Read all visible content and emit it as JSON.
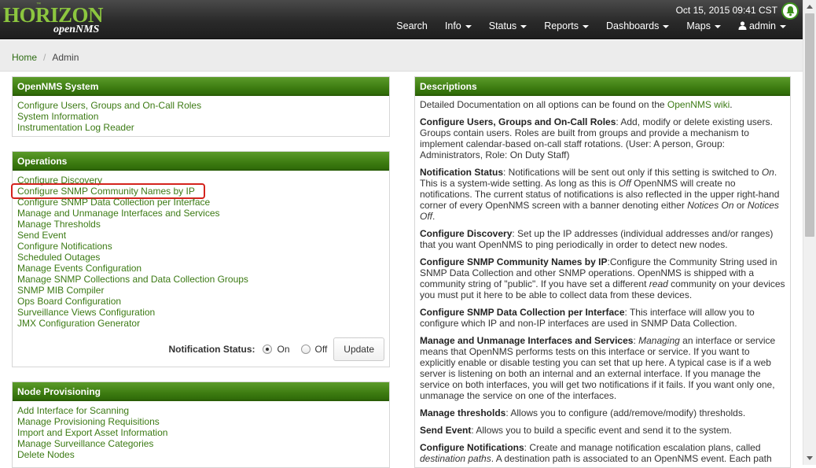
{
  "brand": {
    "logo_main": "HORIZON",
    "logo_sub": "openNMS",
    "logo_tm": "™"
  },
  "header": {
    "datetime": "Oct 15, 2015 09:41 CST",
    "menu": {
      "search": "Search",
      "info": "Info",
      "status": "Status",
      "reports": "Reports",
      "dashboards": "Dashboards",
      "maps": "Maps",
      "user": "admin"
    }
  },
  "breadcrumb": {
    "home": "Home",
    "current": "Admin"
  },
  "opennms_system": {
    "title": "OpenNMS System",
    "links": [
      "Configure Users, Groups and On-Call Roles",
      "System Information",
      "Instrumentation Log Reader"
    ]
  },
  "operations": {
    "title": "Operations",
    "links": [
      "Configure Discovery",
      "Configure SNMP Community Names by IP",
      "Configure SNMP Data Collection per Interface",
      "Manage and Unmanage Interfaces and Services",
      "Manage Thresholds",
      "Send Event",
      "Configure Notifications",
      "Scheduled Outages",
      "Manage Events Configuration",
      "Manage SNMP Collections and Data Collection Groups",
      "SNMP MIB Compiler",
      "Ops Board Configuration",
      "Surveillance Views Configuration",
      "JMX Configuration Generator"
    ],
    "notification_label": "Notification Status:",
    "on_label": "On",
    "off_label": "Off",
    "notification_value": "On",
    "update_button": "Update"
  },
  "node_provisioning": {
    "title": "Node Provisioning",
    "links": [
      "Add Interface for Scanning",
      "Manage Provisioning Requisitions",
      "Import and Export Asset Information",
      "Manage Surveillance Categories",
      "Delete Nodes"
    ]
  },
  "descriptions": {
    "title": "Descriptions",
    "intro_pre": "Detailed Documentation on all options can be found on the ",
    "intro_link": "OpenNMS wiki",
    "intro_post": ".",
    "d1_title": "Configure Users, Groups and On-Call Roles",
    "d1_text": ": Add, modify or delete existing users. Groups contain users. Roles are built from groups and provide a mechanism to implement calendar-based on-call staff rotations. (User: A person, Group: Administrators, Role: On Duty Staff)",
    "d2_title": "Notification Status",
    "d2_a": ": Notifications will be sent out only if this setting is switched to ",
    "d2_on": "On",
    "d2_b": ". This is a system-wide setting. As long as this is ",
    "d2_off": "Off",
    "d2_c": " OpenNMS will create no notifications. The current status of notifications is also reflected in the upper right-hand corner of every OpenNMS screen with a banner denoting either ",
    "d2_notices_on": "Notices On",
    "d2_or": " or ",
    "d2_notices_off": "Notices Off",
    "d2_end": ".",
    "d3_title": "Configure Discovery",
    "d3_text": ": Set up the IP addresses (individual addresses and/or ranges) that you want OpenNMS to ping periodically in order to detect new nodes.",
    "d4_title": "Configure SNMP Community Names by IP",
    "d4_a": ":Configure the Community String used in SNMP Data Collection and other SNMP operations. OpenNMS is shipped with a community string of \"public\". If you have set a different ",
    "d4_read": "read",
    "d4_b": " community on your devices you must put it here to be able to collect data from these devices.",
    "d5_title": "Configure SNMP Data Collection per Interface",
    "d5_text": ": This interface will allow you to configure which IP and non-IP interfaces are used in SNMP Data Collection.",
    "d6_title": "Manage and Unmanage Interfaces and Services",
    "d6_a": ": ",
    "d6_managing": "Managing",
    "d6_b": " an interface or service means that OpenNMS performs tests on this interface or service. If you want to explicitly enable or disable testing you can set that up here. A typical case is if a web server is listening on both an internal and an external interface. If you manage the service on both interfaces, you will get two notifications if it fails. If you want only one, unmanage the service on one of the interfaces.",
    "d7_title": "Manage thresholds",
    "d7_text": ": Allows you to configure (add/remove/modify) thresholds.",
    "d8_title": "Send Event",
    "d8_text": ": Allows you to build a specific event and send it to the system.",
    "d9_title": "Configure Notifications",
    "d9_a": ": Create and manage notification escalation plans, called ",
    "d9_paths": "destination paths",
    "d9_b": ". A destination path is associated to an OpenNMS event. Each path"
  },
  "colors": {
    "panel_header": "#3e7d12",
    "link": "#3c7a14",
    "highlight": "#d4231d"
  }
}
